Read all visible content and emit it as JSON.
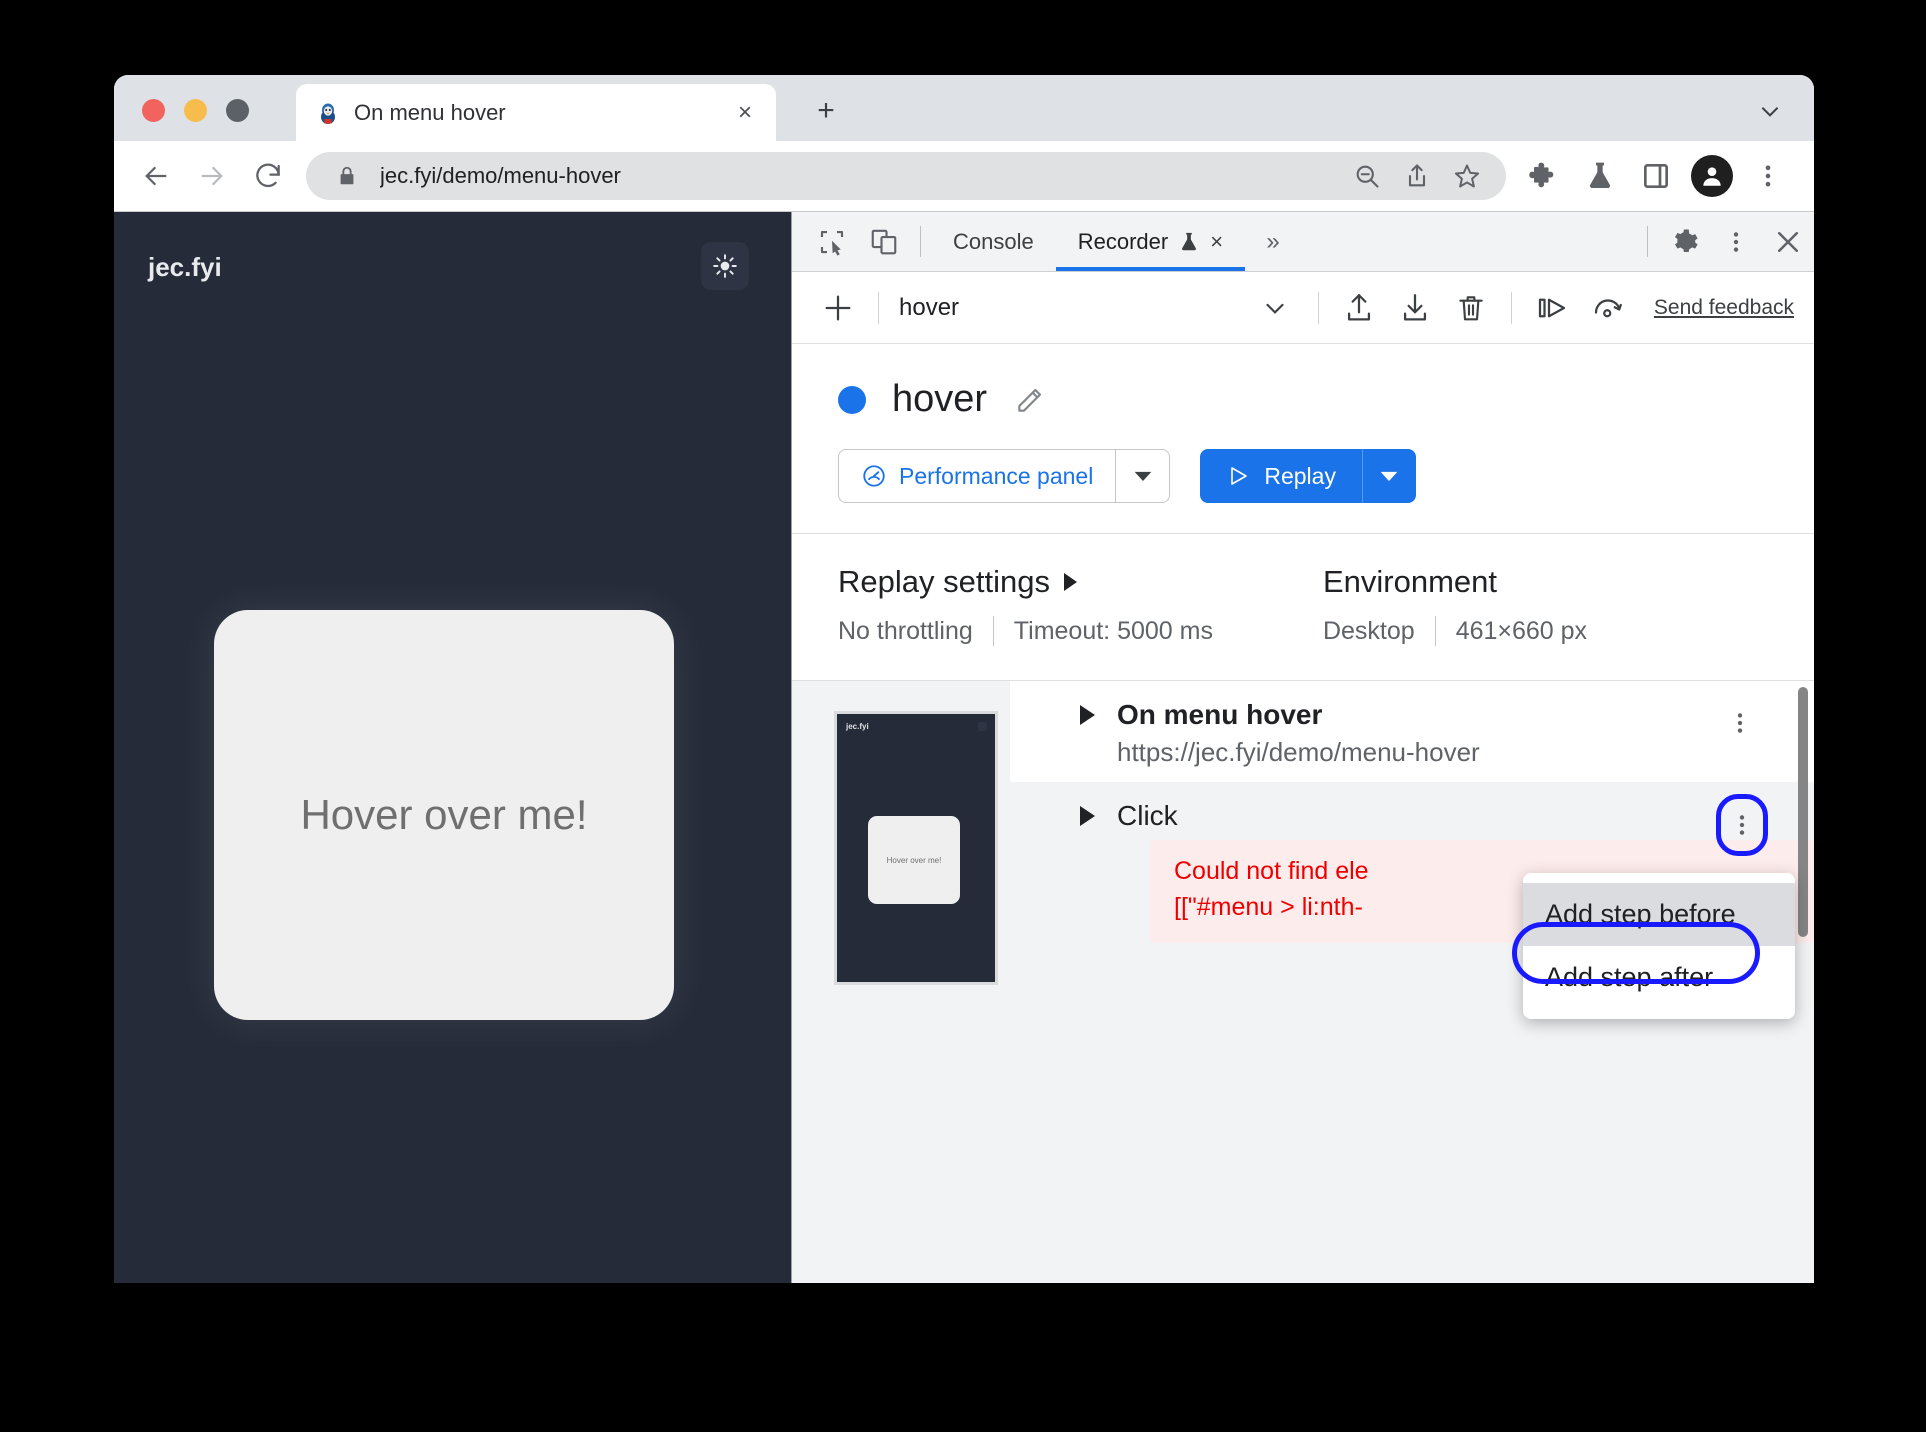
{
  "browser": {
    "tab": {
      "title": "On menu hover",
      "favicon": "penguin-favicon",
      "close": "×"
    },
    "newtab_label": "+",
    "omnibox": {
      "url": "jec.fyi/demo/menu-hover",
      "lock_icon": "lock-icon"
    },
    "toolbar_icons": [
      "zoom-out-icon",
      "share-icon",
      "bookmark-star-icon",
      "extensions-puzzle-icon",
      "experiments-flask-icon",
      "side-panel-icon",
      "profile-avatar-icon",
      "browser-menu-icon"
    ]
  },
  "page": {
    "brand": "jec.fyi",
    "theme_toggle": "sun-icon",
    "card_text": "Hover over me!"
  },
  "devtools": {
    "tabs": [
      {
        "label": "Console",
        "active": false
      },
      {
        "label": "Recorder",
        "active": true,
        "experiment_icon": "flask-icon",
        "close": "×"
      }
    ],
    "more_tabs": "»",
    "right_icons": [
      "settings-gear-icon",
      "devtools-menu-icon",
      "devtools-close-icon"
    ],
    "left_icons": [
      "inspect-element-icon",
      "device-toolbar-icon"
    ]
  },
  "recorder_toolbar": {
    "add_label": "+",
    "selected_recording": "hover",
    "icons": [
      "export-icon",
      "import-icon",
      "delete-icon",
      "step-replay-icon",
      "replay-speed-icon"
    ],
    "feedback_label": "Send feedback"
  },
  "recording": {
    "name": "hover",
    "edit_icon": "pencil-icon",
    "performance_button": "Performance panel",
    "performance_icon": "performance-gauge-icon",
    "replay_button": "Replay",
    "replay_icon": "play-triangle-icon"
  },
  "settings": {
    "replay_heading": "Replay settings",
    "throttling": "No throttling",
    "timeout": "Timeout: 5000 ms",
    "environment_heading": "Environment",
    "device": "Desktop",
    "viewport": "461×660 px"
  },
  "steps": {
    "thumbnail": {
      "brand": "jec.fyi",
      "card_text": "Hover over me!"
    },
    "items": [
      {
        "title": "On menu hover",
        "url": "https://jec.fyi/demo/menu-hover",
        "status": "start",
        "kebab": "step-menu-icon"
      },
      {
        "title": "Click",
        "status": "error",
        "error_icon": "×",
        "kebab": "step-menu-icon",
        "error_lines": [
          "Could not find ele",
          "[[\"#menu > li:nth-"
        ]
      }
    ]
  },
  "context_menu": {
    "items": [
      {
        "label": "Add step before",
        "selected": true
      },
      {
        "label": "Add step after",
        "selected": false
      }
    ]
  },
  "colors": {
    "accent_blue": "#1a73e8",
    "highlight_blue": "#1a1aff",
    "error_red": "#ee0000",
    "page_dark": "#252b38"
  }
}
